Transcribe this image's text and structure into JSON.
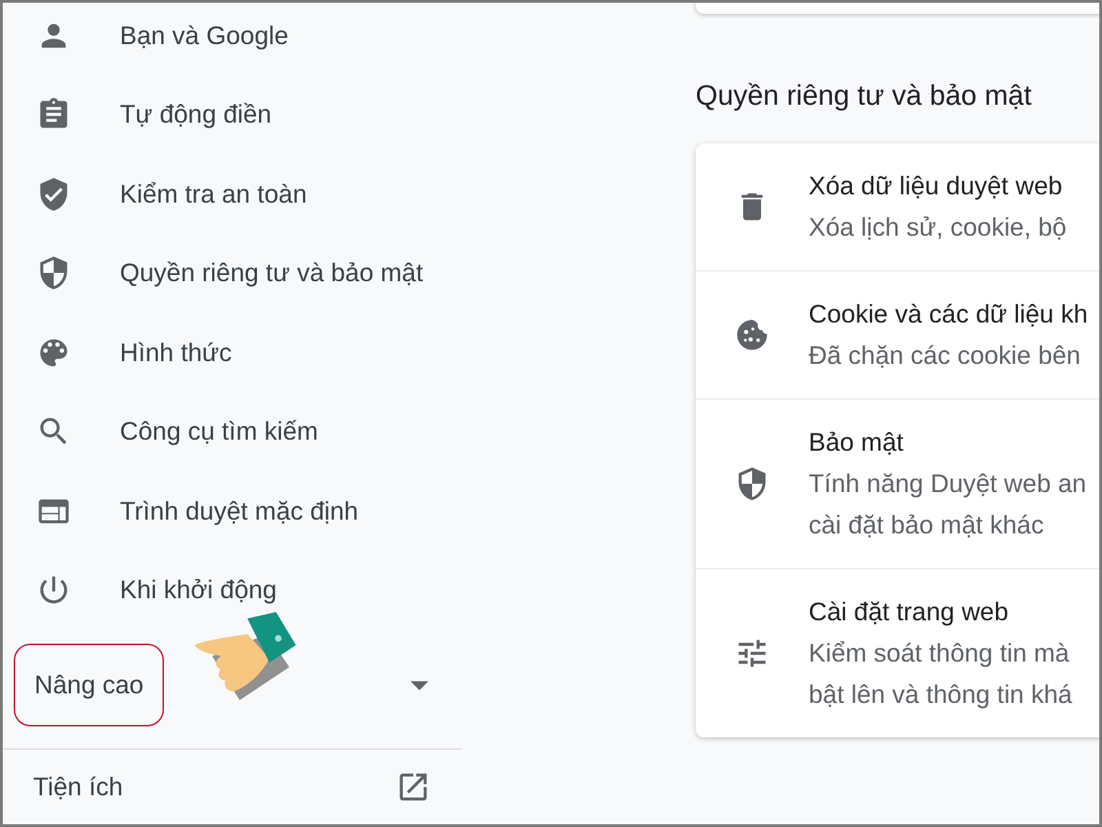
{
  "sidebar": {
    "items": [
      {
        "label": "Bạn và Google"
      },
      {
        "label": "Tự động điền"
      },
      {
        "label": "Kiểm tra an toàn"
      },
      {
        "label": "Quyền riêng tư và bảo mật"
      },
      {
        "label": "Hình thức"
      },
      {
        "label": "Công cụ tìm kiếm"
      },
      {
        "label": "Trình duyệt mặc định"
      },
      {
        "label": "Khi khởi động"
      }
    ],
    "advanced": {
      "label": "Nâng cao",
      "expanded": false,
      "highlighted": true
    },
    "extensions": {
      "label": "Tiện ích"
    }
  },
  "section": {
    "title": "Quyền riêng tư và bảo mật",
    "rows": [
      {
        "title": "Xóa dữ liệu duyệt web",
        "lines": [
          "Xóa lịch sử, cookie, bộ"
        ]
      },
      {
        "title": "Cookie và các dữ liệu kh",
        "lines": [
          "Đã chặn các cookie bên"
        ]
      },
      {
        "title": "Bảo mật",
        "lines": [
          "Tính năng Duyệt web an",
          "cài đặt bảo mật khác"
        ]
      },
      {
        "title": "Cài đặt trang web",
        "lines": [
          "Kiểm soát thông tin mà",
          "bật lên và thông tin khá"
        ]
      }
    ]
  }
}
